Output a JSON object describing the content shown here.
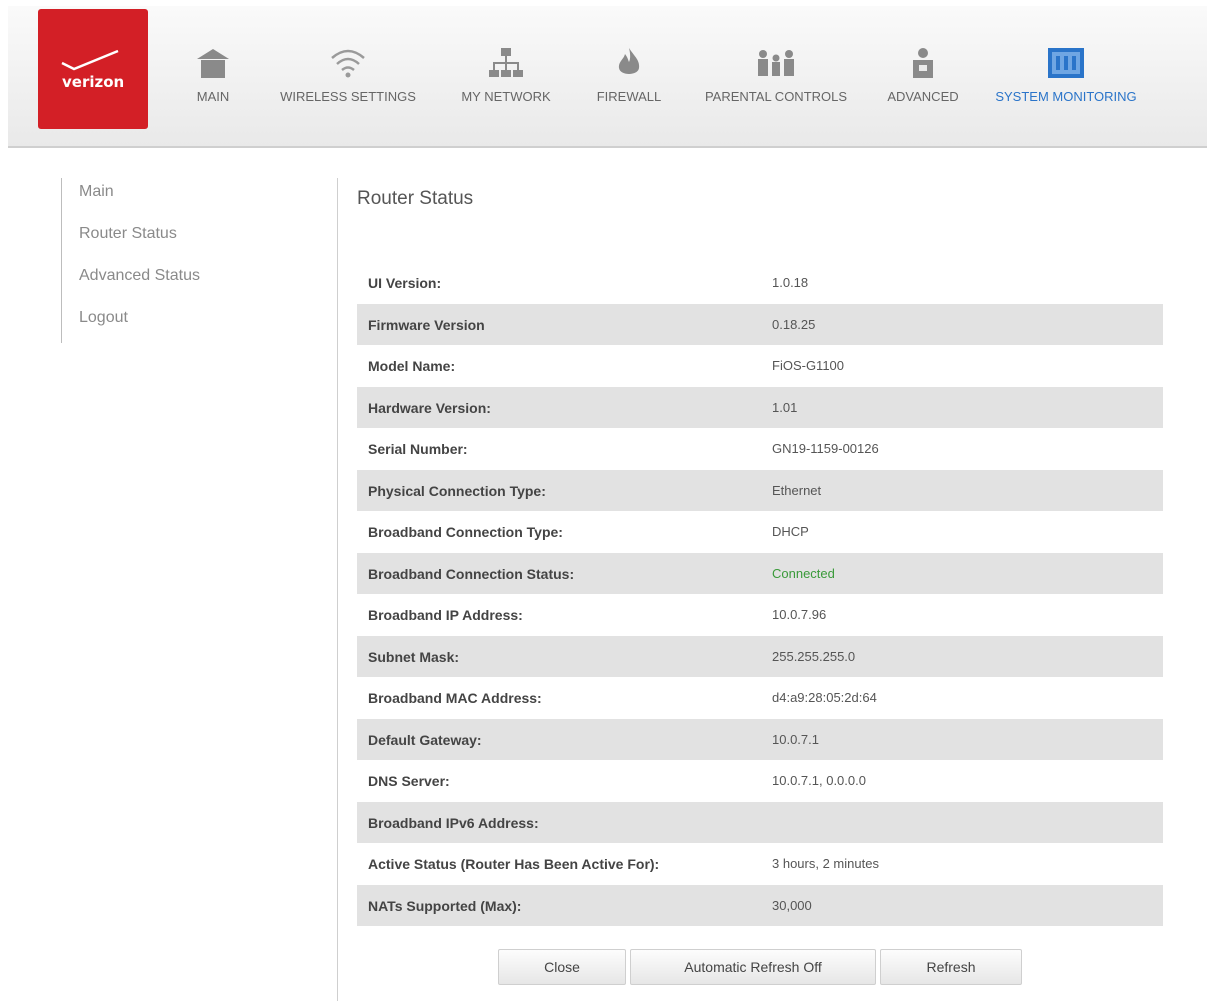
{
  "brand": {
    "logo_text": "verizon",
    "color": "#d31f26"
  },
  "nav": [
    {
      "label": "MAIN",
      "icon": "home-icon"
    },
    {
      "label": "WIRELESS SETTINGS",
      "icon": "wifi-icon"
    },
    {
      "label": "MY NETWORK",
      "icon": "network-icon"
    },
    {
      "label": "FIREWALL",
      "icon": "flame-icon"
    },
    {
      "label": "PARENTAL CONTROLS",
      "icon": "family-icon"
    },
    {
      "label": "ADVANCED",
      "icon": "advanced-user-icon"
    },
    {
      "label": "SYSTEM MONITORING",
      "icon": "monitor-icon",
      "active": true
    }
  ],
  "sidebar": {
    "items": [
      {
        "label": "Main"
      },
      {
        "label": "Router Status"
      },
      {
        "label": "Advanced Status"
      },
      {
        "label": "Logout"
      }
    ]
  },
  "page": {
    "title": "Router Status"
  },
  "status_rows": [
    {
      "label": "UI Version:",
      "value": "1.0.18"
    },
    {
      "label": "Firmware Version",
      "value": "0.18.25"
    },
    {
      "label": "Model Name:",
      "value": "FiOS-G1100"
    },
    {
      "label": "Hardware Version:",
      "value": "1.01"
    },
    {
      "label": "Serial Number:",
      "value": "GN19-1159-00126"
    },
    {
      "label": "Physical Connection Type:",
      "value": "Ethernet"
    },
    {
      "label": "Broadband Connection Type:",
      "value": "DHCP"
    },
    {
      "label": "Broadband Connection Status:",
      "value": "Connected"
    },
    {
      "label": "Broadband IP Address:",
      "value": "10.0.7.96"
    },
    {
      "label": "Subnet Mask:",
      "value": "255.255.255.0"
    },
    {
      "label": "Broadband MAC Address:",
      "value": "d4:a9:28:05:2d:64"
    },
    {
      "label": "Default Gateway:",
      "value": "10.0.7.1"
    },
    {
      "label": "DNS Server:",
      "value": "10.0.7.1, 0.0.0.0"
    },
    {
      "label": "Broadband IPv6 Address:",
      "value": ""
    },
    {
      "label": "Active Status (Router Has Been Active For):",
      "value": "3 hours, 2 minutes"
    },
    {
      "label": "NATs Supported (Max):",
      "value": "30,000"
    }
  ],
  "buttons": {
    "close": "Close",
    "auto_refresh": "Automatic Refresh Off",
    "refresh": "Refresh"
  },
  "colors": {
    "active_nav": "#2a74c9",
    "connected": "#3a9a3a",
    "row_alt": "#e2e2e2"
  }
}
